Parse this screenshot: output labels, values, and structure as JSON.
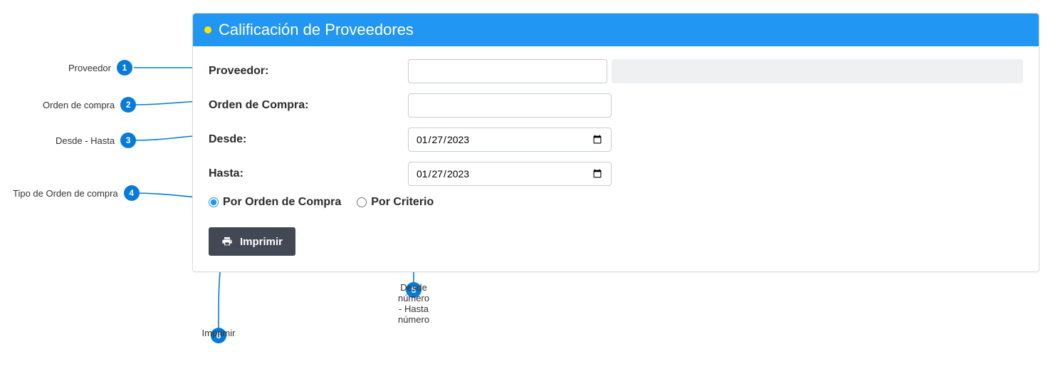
{
  "colors": {
    "header_bg": "#2196f3",
    "status_dot": "#ffe600",
    "badge": "#067bd8",
    "btn_bg": "#424955"
  },
  "panel": {
    "title": "Calificación de Proveedores"
  },
  "form": {
    "proveedor_label": "Proveedor:",
    "proveedor_code_value": "",
    "proveedor_name_value": "",
    "orden_label": "Orden de Compra:",
    "orden_value": "",
    "desde_label": "Desde:",
    "desde_value": "2023-01-27",
    "desde_display": "27/01/2023",
    "hasta_label": "Hasta:",
    "hasta_value": "2023-01-27",
    "hasta_display": "27/01/2023",
    "radio_porOrden": "Por Orden de Compra",
    "radio_porCriterio": "Por Criterio",
    "radio_selected": "porOrden",
    "print_label": "Imprimir"
  },
  "annotations": {
    "a1": {
      "num": "1",
      "label": "Proveedor"
    },
    "a2": {
      "num": "2",
      "label": "Orden de compra"
    },
    "a3": {
      "num": "3",
      "label": "Desde - Hasta"
    },
    "a4": {
      "num": "4",
      "label": "Tipo de Orden de compra"
    },
    "a5": {
      "num": "5",
      "label": "Desde número - Hasta número"
    },
    "a6": {
      "num": "6",
      "label": "Imprimir"
    }
  }
}
